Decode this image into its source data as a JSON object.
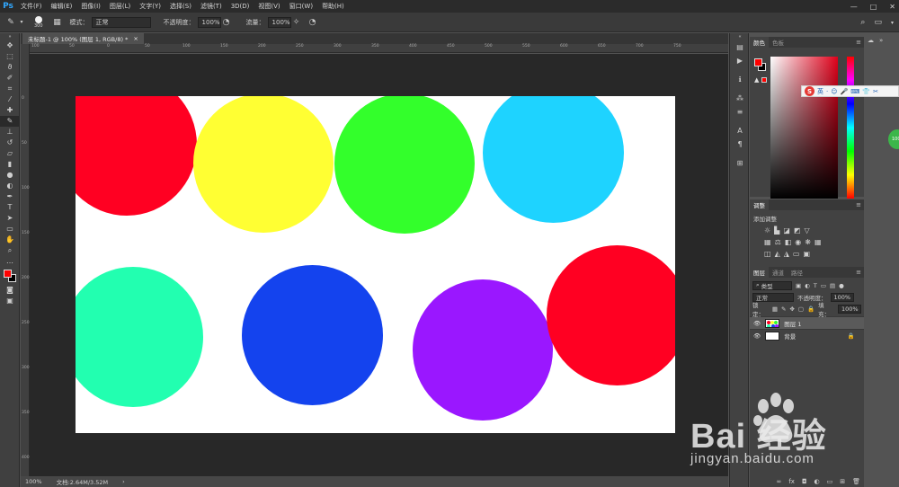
{
  "app": {
    "logo": "Ps"
  },
  "menu": [
    "文件(F)",
    "编辑(E)",
    "图像(I)",
    "图层(L)",
    "文字(Y)",
    "选择(S)",
    "滤镜(T)",
    "3D(D)",
    "视图(V)",
    "窗口(W)",
    "帮助(H)"
  ],
  "window_controls": {
    "minimize": "—",
    "maximize": "□",
    "close": "✕"
  },
  "options": {
    "brush_size": "300",
    "mode_label": "模式：",
    "mode_value": "正常",
    "opacity_label": "不透明度：",
    "opacity_value": "100%",
    "flow_label": "流量：",
    "flow_value": "100%"
  },
  "document": {
    "tab_title": "未标题-1 @ 100% (图层 1, RGB/8) *",
    "close": "×"
  },
  "ruler_h": [
    "100",
    "50",
    "0",
    "50",
    "100",
    "150",
    "200",
    "250",
    "300",
    "350",
    "400",
    "450",
    "500",
    "550",
    "600",
    "650",
    "700",
    "750"
  ],
  "ruler_v": [
    "0",
    "50",
    "100",
    "150",
    "200",
    "250",
    "300",
    "350",
    "400"
  ],
  "statusbar": {
    "zoom": "100%",
    "doc_info": "文档:2.64M/3.52M",
    "arrow": "›"
  },
  "canvas": {
    "circles": [
      {
        "name": "red-circle-top",
        "color": "#ff0022"
      },
      {
        "name": "yellow-circle",
        "color": "#ffff33"
      },
      {
        "name": "green-circle",
        "color": "#33ff2b"
      },
      {
        "name": "cyan-circle",
        "color": "#1ed3ff"
      },
      {
        "name": "teal-circle",
        "color": "#22ffb0"
      },
      {
        "name": "blue-circle",
        "color": "#1443ee"
      },
      {
        "name": "purple-circle",
        "color": "#9a17ff"
      },
      {
        "name": "red-circle-right",
        "color": "#ff0022"
      }
    ]
  },
  "colors": {
    "foreground": "#ff0000",
    "background": "#000000"
  },
  "panels": {
    "color_tabs": [
      "颜色",
      "色板"
    ],
    "adjust_tab": "调整",
    "adjust_add_label": "添加调整",
    "layers_tabs": [
      "图层",
      "通道",
      "路径"
    ],
    "layer_kind": "类型",
    "blend_mode": "正常",
    "opacity_label": "不透明度：",
    "opacity_value": "100%",
    "lock_label": "锁定：",
    "fill_label": "填充：",
    "fill_value": "100%",
    "layers": [
      {
        "name": "图层 1",
        "selected": true
      },
      {
        "name": "背景",
        "selected": false
      }
    ],
    "panel_menu": "≡"
  },
  "ime": {
    "logo": "S",
    "lang": "英"
  },
  "badge": {
    "value": "100"
  },
  "watermark": {
    "brand": "Bai  经验",
    "url": "jingyan.baidu.com"
  }
}
